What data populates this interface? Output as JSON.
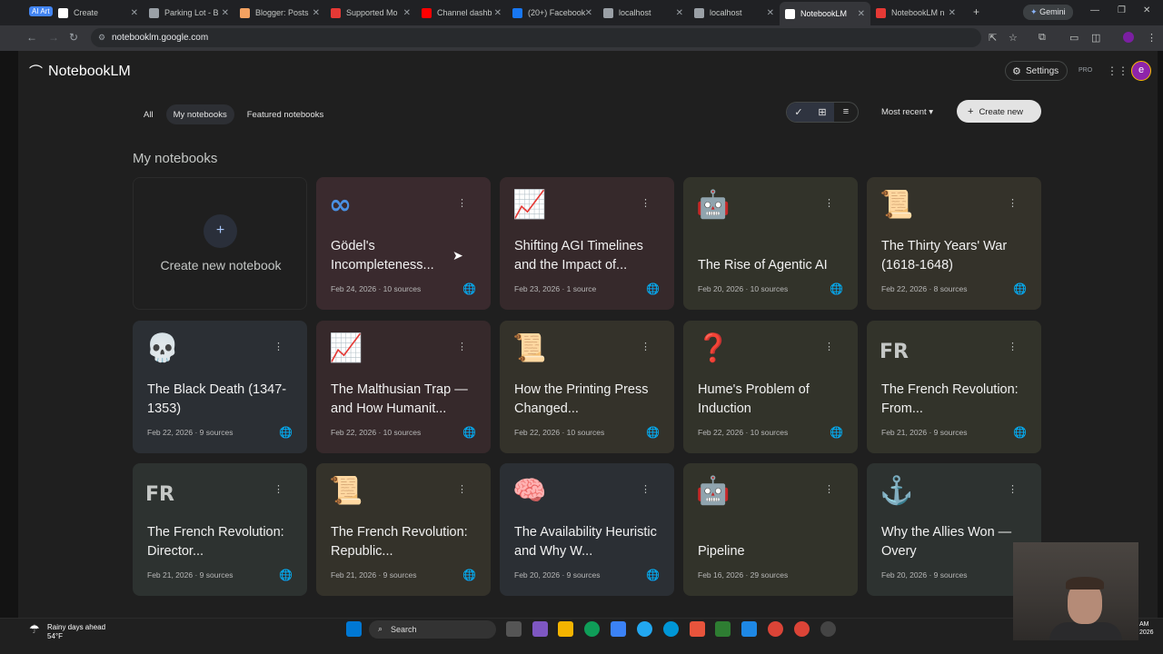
{
  "browser": {
    "badge": "AI Art",
    "tabs": [
      {
        "label": "Create",
        "color": "#ffffff"
      },
      {
        "label": "Parking Lot - B",
        "color": "#9aa0a6"
      },
      {
        "label": "Blogger: Posts",
        "color": "#f4a261"
      },
      {
        "label": "Supported Mo",
        "color": "#e53935"
      },
      {
        "label": "Channel dashb",
        "color": "#ff0000"
      },
      {
        "label": "(20+) Facebook",
        "color": "#1877f2"
      },
      {
        "label": "localhost",
        "color": "#9aa0a6"
      },
      {
        "label": "localhost",
        "color": "#9aa0a6"
      },
      {
        "label": "NotebookLM",
        "color": "#ffffff"
      },
      {
        "label": "NotebookLM n",
        "color": "#e53935"
      }
    ],
    "gemini": "Gemini",
    "url": "notebooklm.google.com"
  },
  "header": {
    "app_name": "NotebookLM",
    "settings": "Settings",
    "pro": "PRO",
    "avatar_initial": "e"
  },
  "filters": [
    "All",
    "My notebooks",
    "Featured notebooks"
  ],
  "toolbar": {
    "sort": "Most recent",
    "create": "Create new"
  },
  "section_title": "My notebooks",
  "create_card": "Create new notebook",
  "notebooks": [
    {
      "icon": "∞",
      "title": "Gödel's Incompleteness...",
      "meta": "Feb 24, 2026 · 10 sources",
      "bg": "#3a2a2e",
      "public": true
    },
    {
      "icon": "📈",
      "title": "Shifting AGI Timelines and the Impact of...",
      "meta": "Feb 23, 2026 · 1 source",
      "bg": "#36292b",
      "public": true
    },
    {
      "icon": "🤖",
      "title": "The Rise of Agentic AI",
      "meta": "Feb 20, 2026 · 10 sources",
      "bg": "#32332a",
      "public": true
    },
    {
      "icon": "📜",
      "title": "The Thirty Years' War (1618-1648)",
      "meta": "Feb 22, 2026 · 8 sources",
      "bg": "#34322a",
      "public": true
    },
    {
      "icon": "💀",
      "title": "The Black Death (1347-1353)",
      "meta": "Feb 22, 2026 · 9 sources",
      "bg": "#2b2f34",
      "public": true
    },
    {
      "icon": "📈",
      "title": "The Malthusian Trap — and How Humanit...",
      "meta": "Feb 22, 2026 · 10 sources",
      "bg": "#36292b",
      "public": true
    },
    {
      "icon": "📜",
      "title": "How the Printing Press Changed...",
      "meta": "Feb 22, 2026 · 10 sources",
      "bg": "#34322a",
      "public": true
    },
    {
      "icon": "❓",
      "title": "Hume's Problem of Induction",
      "meta": "Feb 22, 2026 · 10 sources",
      "bg": "#32332a",
      "public": true
    },
    {
      "icon": "FR",
      "title": "The French Revolution: From...",
      "meta": "Feb 21, 2026 · 9 sources",
      "bg": "#32332a",
      "public": true
    },
    {
      "icon": "FR",
      "title": "The French Revolution: Director...",
      "meta": "Feb 21, 2026 · 9 sources",
      "bg": "#2d3230",
      "public": true
    },
    {
      "icon": "📜",
      "title": "The French Revolution: Republic...",
      "meta": "Feb 21, 2026 · 9 sources",
      "bg": "#34322a",
      "public": true
    },
    {
      "icon": "🧠",
      "title": "The Availability Heuristic and Why W...",
      "meta": "Feb 20, 2026 · 9 sources",
      "bg": "#2b2f34",
      "public": true
    },
    {
      "icon": "🤖",
      "title": "Pipeline",
      "meta": "Feb 16, 2026 · 29 sources",
      "bg": "#32332a",
      "public": false
    },
    {
      "icon": "⚓",
      "title": "Why the Allies Won — Overy",
      "meta": "Feb 20, 2026 · 9 sources",
      "bg": "#2d3230",
      "public": false
    }
  ],
  "taskbar": {
    "weather_line1": "Rainy days ahead",
    "weather_line2": "54°F",
    "search": "Search",
    "clock_line1": "AM",
    "clock_line2": "2026"
  }
}
